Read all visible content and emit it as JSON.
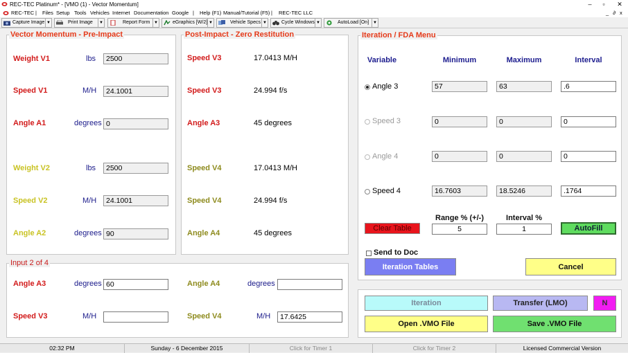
{
  "window": {
    "title": "REC-TEC Platinum* - [VMO (1) - Vector Momentum]",
    "controls": {
      "minimize": "–",
      "restore": "▫",
      "close": "✕",
      "sub": "_ ∂ x"
    }
  },
  "menu": [
    "REC-TEC",
    "|",
    "Files",
    "Setup",
    "Tools",
    "Vehicles",
    "Internet",
    "Documentation",
    "Google",
    "|",
    "Help (F1)",
    "Manual/Tutorial (F5)",
    "|",
    "REC-TEC LLC"
  ],
  "toolbar": {
    "capture": "Capture Image",
    "print": "Print Image",
    "report": "Report Form",
    "egraphics": "eGraphics [W/2]",
    "specs": "Vehicle Specs",
    "cycle": "Cycle Windows",
    "autoload": "AutoLoad [On]"
  },
  "pre_impact": {
    "title": "Vector Momentum - Pre-Impact",
    "rows": [
      {
        "label": "Weight V1",
        "unit": "lbs",
        "value": "2500"
      },
      {
        "label": "Speed V1",
        "unit": "M/H",
        "value": "24.1001"
      },
      {
        "label": "Angle A1",
        "unit": "degrees",
        "value": "0"
      },
      {
        "label": "Weight V2",
        "unit": "lbs",
        "value": "2500"
      },
      {
        "label": "Speed V2",
        "unit": "M/H",
        "value": "24.1001"
      },
      {
        "label": "Angle A2",
        "unit": "degrees",
        "value": "90"
      }
    ]
  },
  "post_impact": {
    "title": "Post-Impact - Zero Restitution",
    "rows": [
      {
        "label": "Speed V3",
        "value": "17.0413  M/H"
      },
      {
        "label": "Speed V3",
        "value": "24.994  f/s"
      },
      {
        "label": "Angle A3",
        "value": "45  degrees"
      },
      {
        "label": "Speed V4",
        "value": "17.0413  M/H"
      },
      {
        "label": "Speed V4",
        "value": "24.994  f/s"
      },
      {
        "label": "Angle A4",
        "value": "45  degrees"
      }
    ]
  },
  "input": {
    "title": "Input 2 of 4",
    "angle_a3": {
      "label": "Angle A3",
      "unit": "degrees",
      "value": "60"
    },
    "angle_a4": {
      "label": "Angle A4",
      "unit": "degrees",
      "value": ""
    },
    "speed_v3": {
      "label": "Speed V3",
      "unit": "M/H",
      "value": ""
    },
    "speed_v4": {
      "label": "Speed V4",
      "unit": "M/H",
      "value": "17.6425"
    }
  },
  "iteration": {
    "title": "Iteration / FDA Menu",
    "headers": {
      "variable": "Variable",
      "minimum": "Minimum",
      "maximum": "Maximum",
      "interval": "Interval"
    },
    "rows": [
      {
        "label": "Angle 3",
        "min": "57",
        "max": "63",
        "interval": ".6",
        "selected": true
      },
      {
        "label": "Speed 3",
        "min": "0",
        "max": "0",
        "interval": "0",
        "selected": false
      },
      {
        "label": "Angle 4",
        "min": "0",
        "max": "0",
        "interval": "0",
        "selected": false
      },
      {
        "label": "Speed 4",
        "min": "16.7603",
        "max": "18.5246",
        "interval": ".1764",
        "selected": false
      }
    ],
    "range_label": "Range % (+/-)",
    "range_value": "5",
    "interval_pct_label": "Interval %",
    "interval_pct_value": "1",
    "clear_table": "Clear Table",
    "autofill": "AutoFill",
    "send_to_doc": "Send to Doc",
    "iteration_tables": "Iteration Tables",
    "cancel": "Cancel"
  },
  "actions": {
    "iteration": "Iteration",
    "transfer": "Transfer (LMO)",
    "n": "N",
    "open": "Open .VMO File",
    "save": "Save .VMO File"
  },
  "status": {
    "time": "02:32 PM",
    "date": "Sunday  -  6 December 2015",
    "timer1": "Click for Timer 1",
    "timer2": "Click for Timer 2",
    "license": "Licensed Commercial Version"
  },
  "colors": {
    "accent_red": "#d21b1b",
    "title_orange": "#e53a1a",
    "yellow_text": "#c9c324",
    "navy": "#1c1c8e"
  }
}
